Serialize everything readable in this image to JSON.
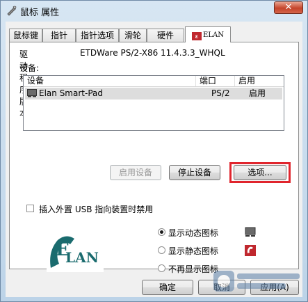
{
  "window": {
    "title": "鼠标 属性",
    "close_symbol": "✕"
  },
  "tabs": [
    {
      "label": "鼠标键",
      "active": false
    },
    {
      "label": "指针",
      "active": false
    },
    {
      "label": "指针选项",
      "active": false
    },
    {
      "label": "滑轮",
      "active": false
    },
    {
      "label": "硬件",
      "active": false
    },
    {
      "label": "ELAN",
      "active": true
    }
  ],
  "driver": {
    "label": "驱动程序版本:",
    "value": "ETDWare PS/2-X86 11.4.3.3_WHQL"
  },
  "devices": {
    "label": "设备:",
    "columns": [
      "设备",
      "端口",
      "启用"
    ],
    "rows": [
      {
        "name": "Elan Smart-Pad",
        "port": "PS/2",
        "enabled": "启用",
        "selected": true
      }
    ]
  },
  "device_buttons": {
    "enable": "启用设备",
    "stop": "停止设备",
    "options": "选项..."
  },
  "usb_checkbox": {
    "label": "插入外置 USB 指向装置时禁用",
    "checked": false
  },
  "logo": {
    "text": "LAN",
    "e_letter": "E"
  },
  "tray_icon_options": [
    {
      "label": "显示动态图标",
      "selected": true,
      "icon": "touchpad-gray-icon"
    },
    {
      "label": "显示静态图标",
      "selected": false,
      "icon": "elan-red-icon"
    },
    {
      "label": "不再显示图标",
      "selected": false,
      "icon": ""
    }
  ],
  "footer_buttons": {
    "ok": "确定",
    "cancel": "取消",
    "apply": "应用(A)"
  },
  "colors": {
    "highlight_box": "#e0252d",
    "logo_teal": "#1a6b6e",
    "elan_red": "#c0282e"
  }
}
